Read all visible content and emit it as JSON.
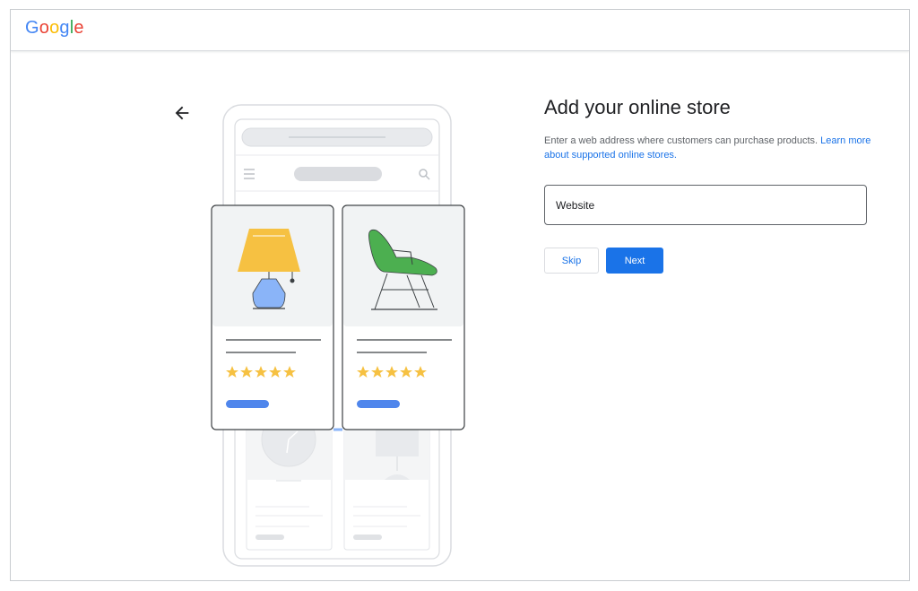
{
  "header": {
    "logo_text": "Google",
    "logo_colors": [
      "#4285F4",
      "#EA4335",
      "#FBBC05",
      "#4285F4",
      "#34A853",
      "#EA4335"
    ]
  },
  "nav": {
    "back_icon": "arrow-left-icon"
  },
  "main": {
    "title": "Add your online store",
    "description": "Enter a web address where customers can purchase products. ",
    "learn_more_link": "Learn more about supported online stores.",
    "website_input": {
      "placeholder": "Website",
      "value": ""
    },
    "skip_label": "Skip",
    "next_label": "Next"
  },
  "illustration": {
    "product_cards": [
      {
        "name": "lamp",
        "rating": 5
      },
      {
        "name": "chair",
        "rating": 5
      }
    ],
    "colors": {
      "lamp_shade": "#F6C142",
      "lamp_base": "#8AB4F8",
      "chair": "#4CAF50",
      "star": "#F6C142",
      "button_pill": "#4F86EC"
    }
  },
  "theme": {
    "primary": "#1a73e8",
    "text": "#202124",
    "muted": "#5f6368",
    "border": "#dadce0"
  }
}
